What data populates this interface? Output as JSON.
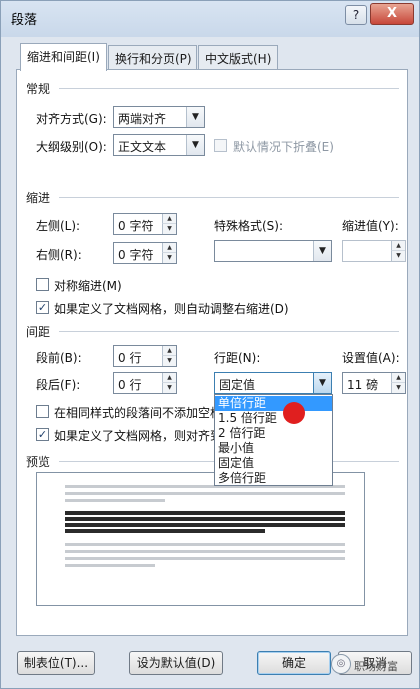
{
  "window": {
    "title": "段落",
    "help_label": "?",
    "close_label": "X"
  },
  "tabs": [
    {
      "label": "缩进和间距(I)",
      "active": true
    },
    {
      "label": "换行和分页(P)",
      "active": false
    },
    {
      "label": "中文版式(H)",
      "active": false
    }
  ],
  "general": {
    "section_label": "常规",
    "alignment_label": "对齐方式(G):",
    "alignment_value": "两端对齐",
    "outline_label": "大纲级别(O):",
    "outline_value": "正文文本",
    "collapse_label": "默认情况下折叠(E)"
  },
  "indent": {
    "section_label": "缩进",
    "left_label": "左侧(L):",
    "left_value": "0 字符",
    "right_label": "右侧(R):",
    "right_value": "0 字符",
    "special_label": "特殊格式(S):",
    "special_value": "",
    "indent_by_label": "缩进值(Y):",
    "indent_by_value": "",
    "mirror_label": "对称缩进(M)",
    "auto_adjust_label": "如果定义了文档网格，则自动调整右缩进(D)"
  },
  "spacing": {
    "section_label": "间距",
    "before_label": "段前(B):",
    "before_value": "0 行",
    "after_label": "段后(F):",
    "after_value": "0 行",
    "line_spacing_label": "行距(N):",
    "line_spacing_value": "固定值",
    "at_label": "设置值(A):",
    "at_value": "11 磅",
    "no_space_label": "在相同样式的段落间不添加空格",
    "snap_grid_label": "如果定义了文档网格，则对齐到网格"
  },
  "line_spacing_options": [
    "单倍行距",
    "1.5 倍行距",
    "2 倍行距",
    "最小值",
    "固定值",
    "多倍行距"
  ],
  "line_spacing_highlighted": "单倍行距",
  "preview": {
    "section_label": "预览"
  },
  "buttons": {
    "tabs_label": "制表位(T)...",
    "default_label": "设为默认值(D)",
    "ok_label": "确定",
    "cancel_label": "取消"
  },
  "watermark": {
    "text": "职场财富"
  },
  "icons": {
    "dropdown_arrow": "▼",
    "spin_up": "▲",
    "spin_down": "▼",
    "check": "✓"
  }
}
